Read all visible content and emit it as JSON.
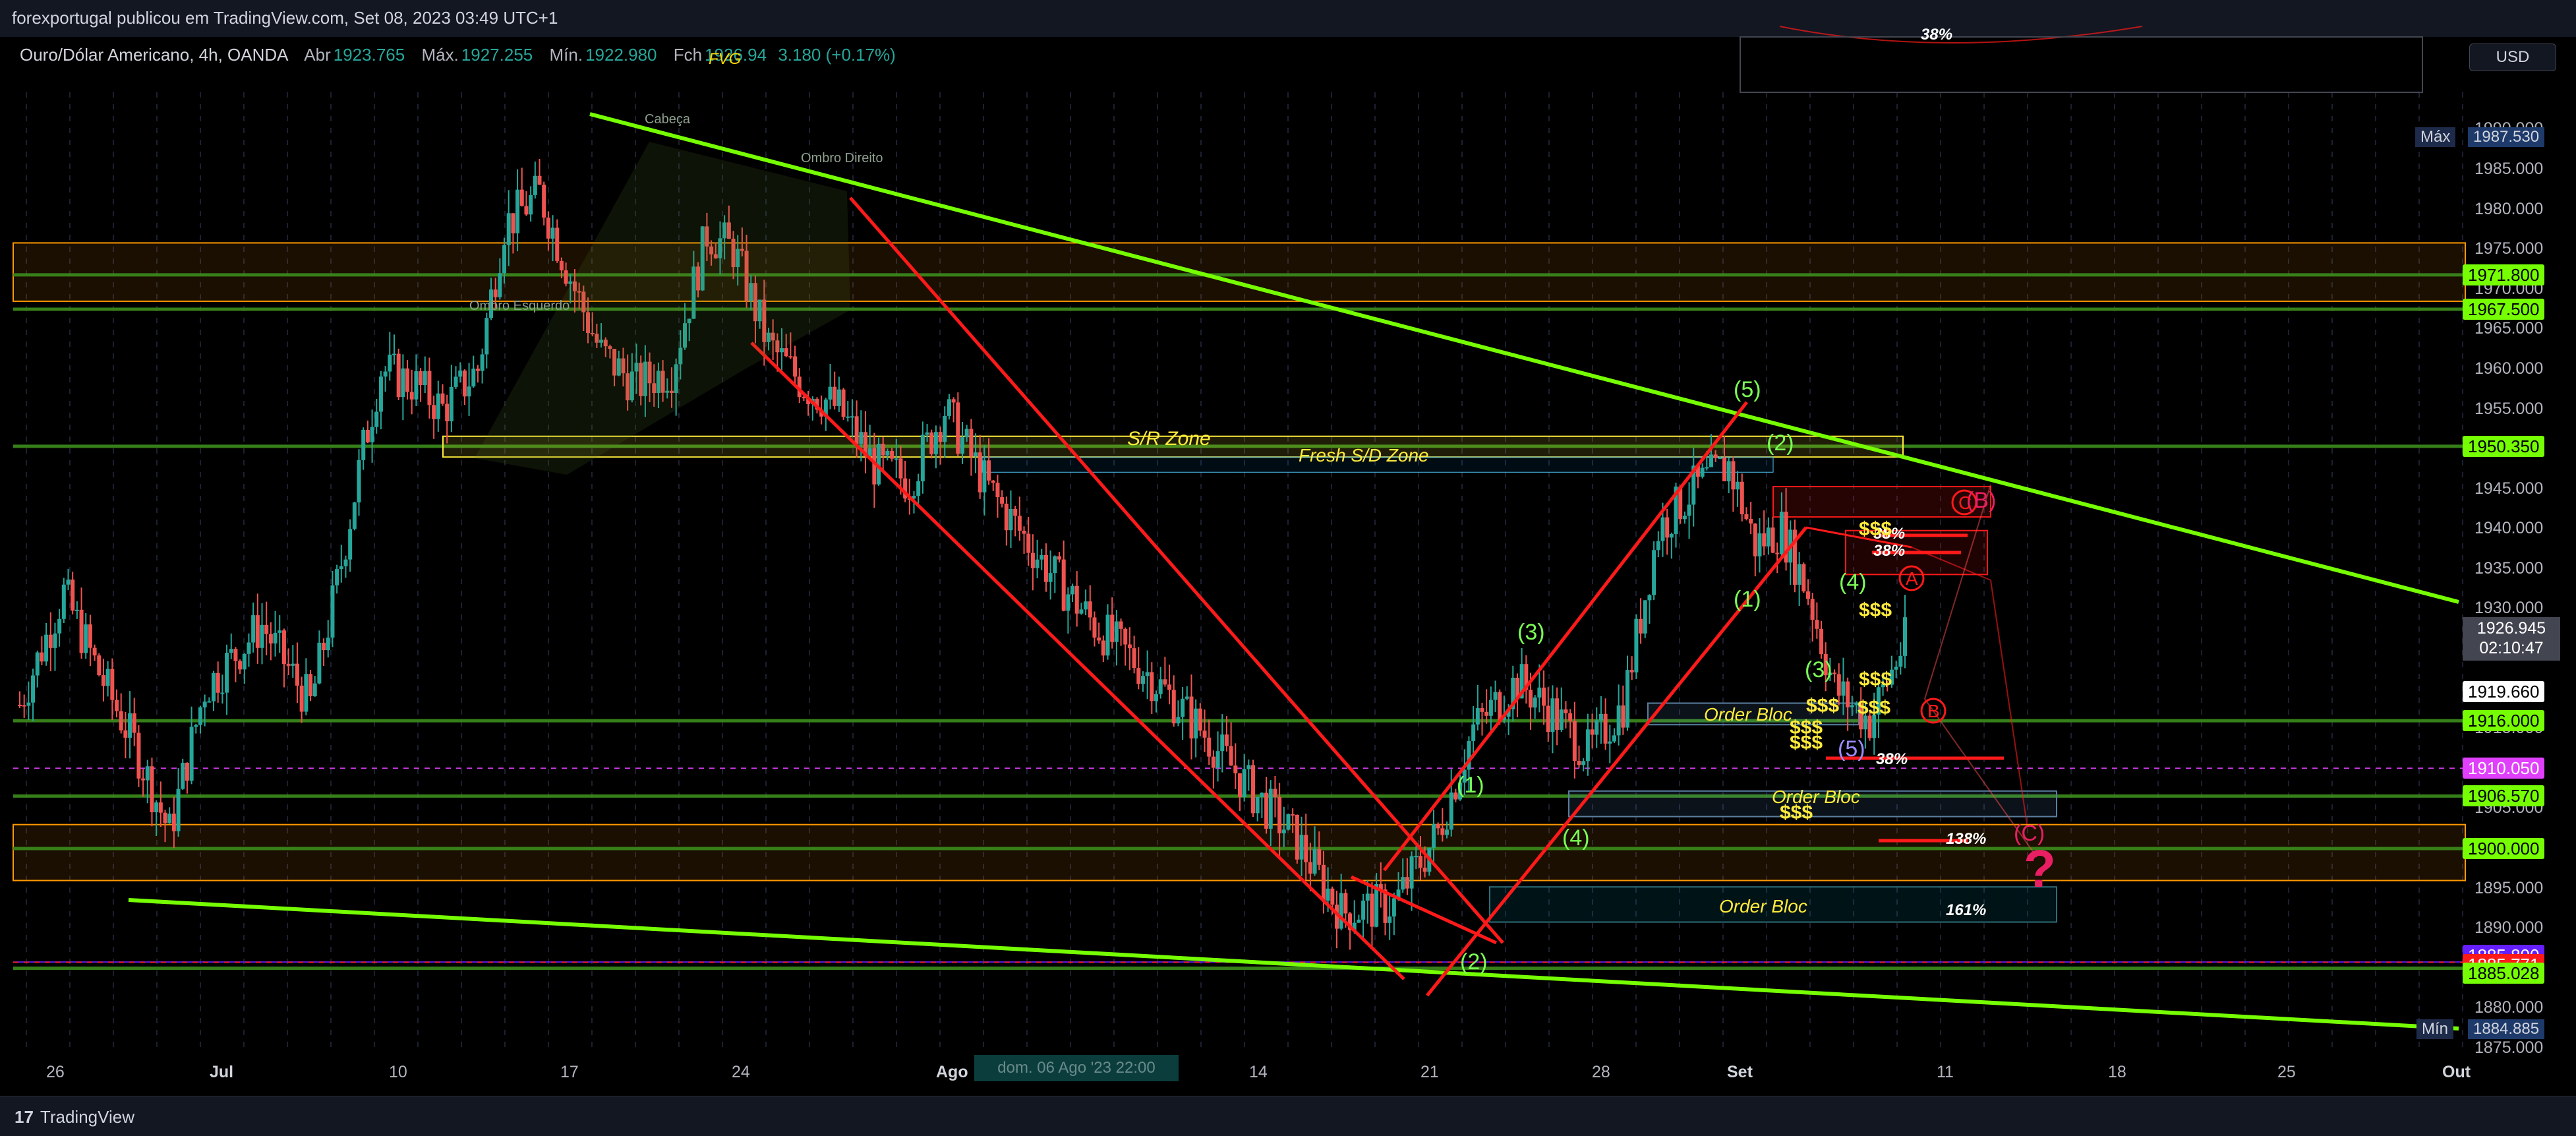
{
  "header": {
    "publish_line": "forexportugal publicou em TradingView.com, Set 08, 2023 03:49 UTC+1",
    "symbol": "Ouro/Dólar Americano, 4h, OANDA",
    "open_label": "Abr",
    "open": "1923.765",
    "high_label": "Máx.",
    "high": "1927.255",
    "low_label": "Mín.",
    "low": "1922.980",
    "close_label": "Fch",
    "close": "1926.94",
    "change": "3.180 (+0.17%)",
    "fvg_label": "FVG"
  },
  "currency_button": "USD",
  "footer": {
    "brand": "TradingView",
    "brand_mark": "17"
  },
  "crosshair_date": "dom. 06 Ago '23   22:00",
  "current_price": {
    "price": "1926.945",
    "countdown": "02:10:47"
  },
  "max_label": {
    "label": "Máx",
    "value": "1987.530"
  },
  "min_label": {
    "label": "Mín",
    "value": "1884.885"
  },
  "colors": {
    "bull": "#26a69a",
    "bear": "#ef5350",
    "trendline": "#76ff03",
    "channel": "#ff1a1a",
    "zone_yellow": "#ffeb3b",
    "level_green": "#3c8d1c",
    "orange_zone": "#ff9800"
  },
  "chart_data": {
    "type": "candlestick",
    "title": "Ouro/Dólar Americano, 4h, OANDA",
    "ylim": [
      1875,
      1993
    ],
    "y_ticks": [
      "1990.000",
      "1985.000",
      "1980.000",
      "1975.000",
      "1970.000",
      "1965.000",
      "1960.000",
      "1955.000",
      "1950.000",
      "1945.000",
      "1940.000",
      "1935.000",
      "1930.000",
      "1925.000",
      "1920.000",
      "1915.000",
      "1910.000",
      "1905.000",
      "1900.000",
      "1895.000",
      "1890.000",
      "1885.000",
      "1880.000",
      "1875.000"
    ],
    "x_ticks": [
      "26",
      "Jul",
      "10",
      "17",
      "24",
      "Ago",
      "7",
      "14",
      "21",
      "28",
      "Set",
      "11",
      "18",
      "25",
      "Out"
    ],
    "x_ticks_bold": [
      "Jul",
      "Ago",
      "Set",
      "Out"
    ],
    "price_levels": [
      {
        "label": "1971.800",
        "value": 1971.8,
        "color": "#76ff03"
      },
      {
        "label": "1967.500",
        "value": 1967.5,
        "color": "#76ff03"
      },
      {
        "label": "1950.350",
        "value": 1950.35,
        "color": "#76ff03"
      },
      {
        "label": "1919.660",
        "value": 1919.66,
        "color": "#ffffff"
      },
      {
        "label": "1916.000",
        "value": 1916.0,
        "color": "#76ff03"
      },
      {
        "label": "1910.050",
        "value": 1910.05,
        "color": "#e040fb"
      },
      {
        "label": "1906.570",
        "value": 1906.57,
        "color": "#76ff03"
      },
      {
        "label": "1900.000",
        "value": 1900.0,
        "color": "#76ff03"
      },
      {
        "label": "1885.800",
        "value": 1885.8,
        "color": "#651fff"
      },
      {
        "label": "1885.771",
        "value": 1885.771,
        "color": "#ff1a1a"
      },
      {
        "label": "1885.028",
        "value": 1885.028,
        "color": "#76ff03"
      }
    ],
    "candles_anchor_path": [
      [
        0,
        1918
      ],
      [
        10,
        1932
      ],
      [
        18,
        1922
      ],
      [
        26,
        1913
      ],
      [
        34,
        1902
      ],
      [
        42,
        1920
      ],
      [
        55,
        1928
      ],
      [
        66,
        1918
      ],
      [
        72,
        1933
      ],
      [
        78,
        1950
      ],
      [
        82,
        1960
      ],
      [
        90,
        1958
      ],
      [
        96,
        1955
      ],
      [
        104,
        1960
      ],
      [
        110,
        1978
      ],
      [
        118,
        1982
      ],
      [
        126,
        1970
      ],
      [
        132,
        1962
      ],
      [
        140,
        1958
      ],
      [
        148,
        1960
      ],
      [
        156,
        1977
      ],
      [
        162,
        1975
      ],
      [
        170,
        1963
      ],
      [
        178,
        1958
      ],
      [
        186,
        1955
      ],
      [
        194,
        1948
      ],
      [
        202,
        1946
      ],
      [
        210,
        1955
      ],
      [
        220,
        1945
      ],
      [
        232,
        1936
      ],
      [
        244,
        1928
      ],
      [
        256,
        1922
      ],
      [
        268,
        1915
      ],
      [
        280,
        1907
      ],
      [
        290,
        1901
      ],
      [
        300,
        1892
      ],
      [
        312,
        1893
      ],
      [
        322,
        1902
      ],
      [
        330,
        1915
      ],
      [
        340,
        1921
      ],
      [
        348,
        1917
      ],
      [
        356,
        1912
      ],
      [
        364,
        1918
      ],
      [
        372,
        1940
      ],
      [
        380,
        1945
      ],
      [
        388,
        1948
      ],
      [
        394,
        1938
      ],
      [
        400,
        1940
      ],
      [
        406,
        1932
      ],
      [
        412,
        1920
      ],
      [
        420,
        1916
      ],
      [
        428,
        1926
      ]
    ],
    "annotations": {
      "head_shoulders": [
        "Ombro Esquerdo",
        "Cabeça",
        "Ombro Direito"
      ],
      "zones": [
        "S/R Zone",
        "Fresh S/D Zone",
        "Order Bloc",
        "Order Bloc",
        "Order Bloc"
      ],
      "elliott_waves": [
        "(1)",
        "(2)",
        "(3)",
        "(4)",
        "(5)",
        "(1)",
        "(2)",
        "(3)",
        "(4)",
        "(5)",
        "(C)",
        "(B)"
      ],
      "abc_labels": [
        "A",
        "B",
        "C"
      ],
      "fib_labels": [
        "38%",
        "38%",
        "38%",
        "38%",
        "138%",
        "161%"
      ],
      "liquidity": [
        "$$$",
        "$$$",
        "$$$",
        "$$$",
        "$$$",
        "$$$",
        "$$$",
        "$$$"
      ],
      "question": "?"
    }
  }
}
